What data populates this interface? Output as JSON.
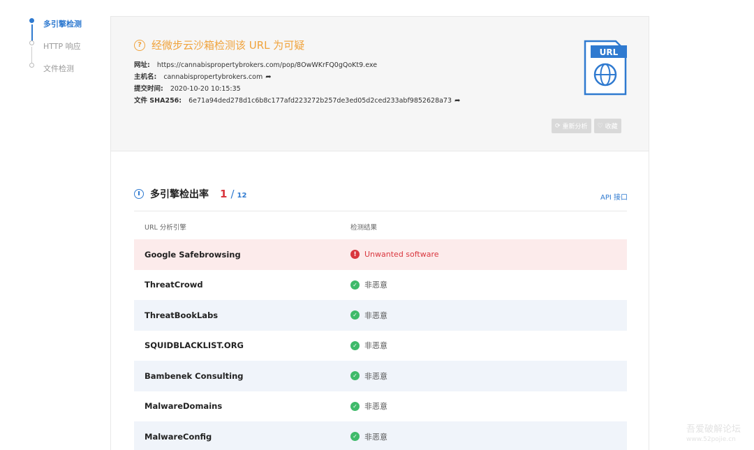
{
  "nav": {
    "items": [
      {
        "label": "多引擎检测",
        "active": true
      },
      {
        "label": "HTTP 响应",
        "active": false
      },
      {
        "label": "文件检测",
        "active": false
      }
    ]
  },
  "summary": {
    "verdict_icon": "question-circle-icon",
    "verdict": "经微步云沙箱检测该 URL 为可疑",
    "url_label": "网址:",
    "url": "https://cannabispropertybrokers.com/pop/8OwWKrFQ0gQoKt9.exe",
    "host_label": "主机名:",
    "host": "cannabispropertybrokers.com",
    "time_label": "提交时间:",
    "time": "2020-10-20 10:15:35",
    "sha_label": "文件 SHA256:",
    "sha": "6e71a94ded278d1c6b8c177afd223272b257de3ed05d2ced233abf9852628a73",
    "badge": "URL",
    "reanalyze": "重新分析",
    "favorite": "收藏",
    "colors": {
      "suspicious": "#f0a33c",
      "accent": "#2f7ad0",
      "malicious": "#d9363e",
      "safe": "#3fba6a"
    }
  },
  "engines": {
    "title": "多引擎检出率",
    "hits": "1",
    "slash": "/",
    "total": "12",
    "api": "API 接口",
    "col_engine": "URL 分析引擎",
    "col_result": "检测结果",
    "rows": [
      {
        "engine": "Google Safebrowsing",
        "result": "Unwanted software",
        "status": "malicious"
      },
      {
        "engine": "ThreatCrowd",
        "result": "非恶意",
        "status": "safe"
      },
      {
        "engine": "ThreatBookLabs",
        "result": "非恶意",
        "status": "safe"
      },
      {
        "engine": "SQUIDBLACKLIST.ORG",
        "result": "非恶意",
        "status": "safe"
      },
      {
        "engine": "Bambenek Consulting",
        "result": "非恶意",
        "status": "safe"
      },
      {
        "engine": "MalwareDomains",
        "result": "非恶意",
        "status": "safe"
      },
      {
        "engine": "MalwareConfig",
        "result": "非恶意",
        "status": "safe"
      }
    ]
  },
  "watermark": {
    "line1": "吾爱破解论坛",
    "line2": "www.52pojie.cn"
  }
}
